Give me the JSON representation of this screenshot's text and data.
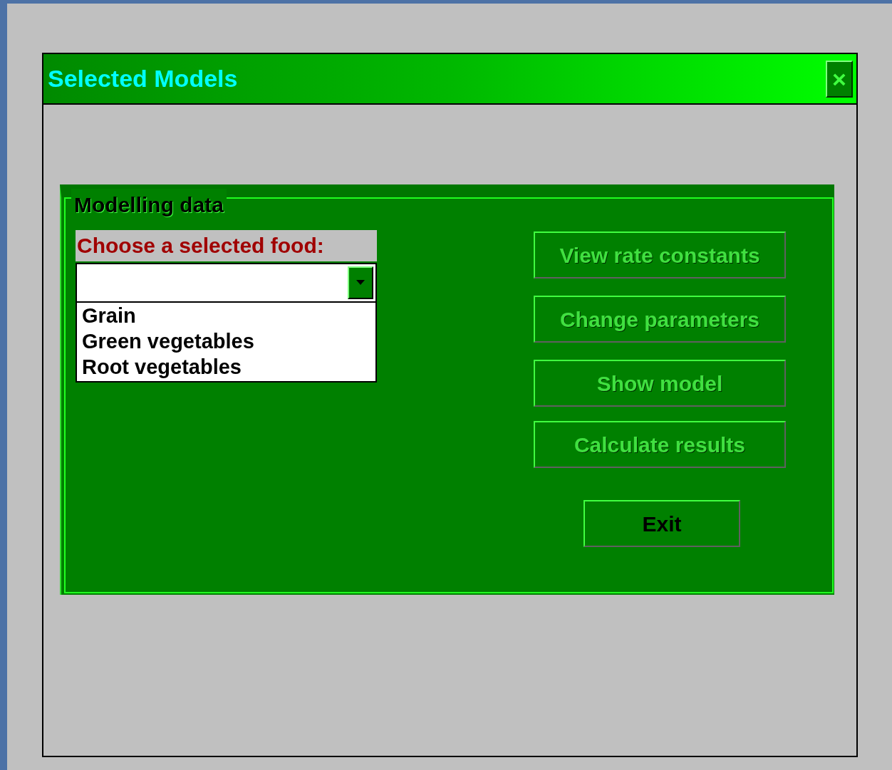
{
  "window": {
    "title": "Selected Models",
    "close": "×"
  },
  "group": {
    "label": "Modelling data"
  },
  "food": {
    "label": "Choose a selected food:",
    "expanded": true,
    "options": [
      {
        "label": "Grain",
        "selected": false
      },
      {
        "label": "Green vegetables",
        "selected": false
      },
      {
        "label": "Root vegetables",
        "selected": false
      }
    ]
  },
  "buttons": [
    {
      "label": "View rate constants",
      "disabled": true
    },
    {
      "label": "Change parameters",
      "disabled": true
    },
    {
      "label": "Show model",
      "disabled": true
    },
    {
      "label": "Calculate results",
      "disabled": true
    }
  ],
  "exit": {
    "label": "Exit",
    "disabled": false
  }
}
